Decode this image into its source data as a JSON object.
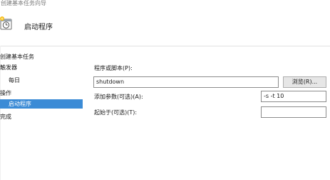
{
  "window": {
    "title": "创建基本任务向导"
  },
  "header": {
    "title": "启动程序",
    "icon": "clock-calendar-icon"
  },
  "nav": {
    "items": [
      {
        "label": "创建基本任务",
        "indent": false,
        "selected": false
      },
      {
        "label": "触发器",
        "indent": false,
        "selected": false
      },
      {
        "label": "每日",
        "indent": true,
        "selected": false
      },
      {
        "label": "操作",
        "indent": false,
        "selected": false
      },
      {
        "label": "启动程序",
        "indent": true,
        "selected": true
      },
      {
        "label": "完成",
        "indent": false,
        "selected": false
      }
    ]
  },
  "form": {
    "program_label": "程序或脚本(P):",
    "program_value": "shutdown",
    "browse_label": "浏览(R)...",
    "args_label": "添加参数(可选)(A):",
    "args_value": "-s -t 10",
    "startin_label": "起始于(可选)(T):",
    "startin_value": ""
  },
  "colors": {
    "selected_bg": "#3b8bd6",
    "border": "#8c8c8c"
  }
}
